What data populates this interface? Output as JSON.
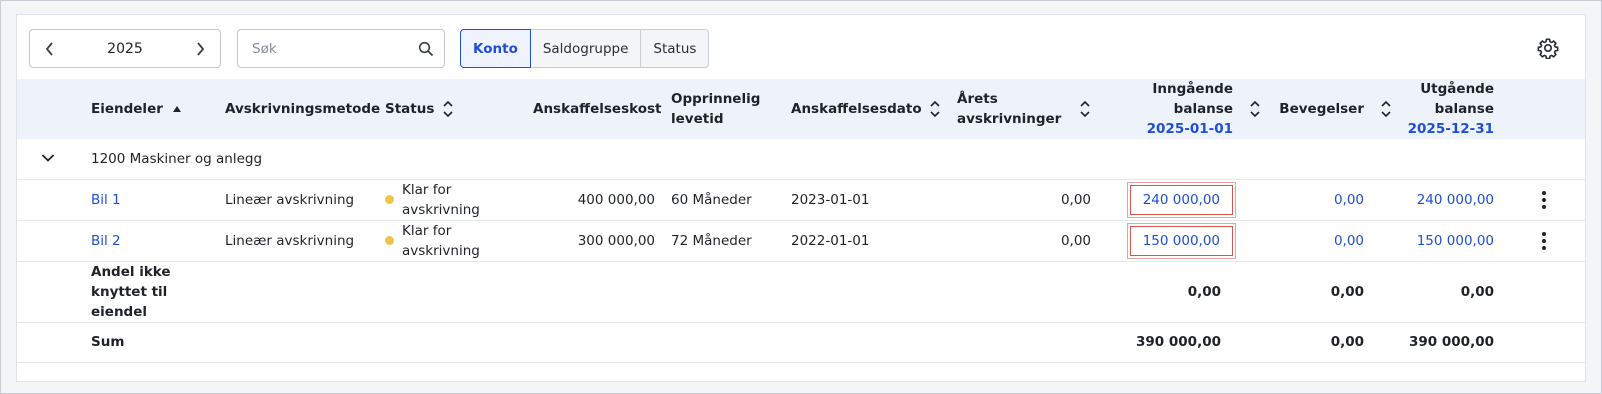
{
  "toolbar": {
    "year": "2025",
    "search_placeholder": "Søk",
    "tabs": [
      "Konto",
      "Saldogruppe",
      "Status"
    ]
  },
  "headers": {
    "eiendeler": "Eiendeler",
    "metode": "Avskrivningsmetode",
    "status": "Status",
    "kost": "Anskaffelseskost",
    "levetid_1": "Opprinnelig",
    "levetid_2": "levetid",
    "dato": "Anskaffelsesdato",
    "arets_1": "Årets",
    "arets_2": "avskrivninger",
    "inngaende_1": "Inngående",
    "inngaende_2": "balanse",
    "inngaende_date": "2025-01-01",
    "bevegelser": "Bevegelser",
    "utgaende_1": "Utgående",
    "utgaende_2": "balanse",
    "utgaende_date": "2025-12-31"
  },
  "group": {
    "label": "1200 Maskiner og anlegg"
  },
  "rows": [
    {
      "name": "Bil 1",
      "method": "Lineær avskrivning",
      "status_1": "Klar for",
      "status_2": "avskrivning",
      "cost": "400 000,00",
      "life": "60 Måneder",
      "date": "2023-01-01",
      "yearly": "0,00",
      "opening": "240 000,00",
      "movements": "0,00",
      "closing": "240 000,00"
    },
    {
      "name": "Bil 2",
      "method": "Lineær avskrivning",
      "status_1": "Klar for",
      "status_2": "avskrivning",
      "cost": "300 000,00",
      "life": "72 Måneder",
      "date": "2022-01-01",
      "yearly": "0,00",
      "opening": "150 000,00",
      "movements": "0,00",
      "closing": "150 000,00"
    }
  ],
  "unlinked": {
    "line1": "Andel ikke",
    "line2": "knyttet til",
    "line3": "eiendel",
    "opening": "0,00",
    "movements": "0,00",
    "closing": "0,00"
  },
  "sum": {
    "label": "Sum",
    "opening": "390 000,00",
    "movements": "0,00",
    "closing": "390 000,00"
  },
  "colors": {
    "accent": "#1f4fd6",
    "status_dot": "#f0c24b",
    "highlight": "#d9534f"
  }
}
